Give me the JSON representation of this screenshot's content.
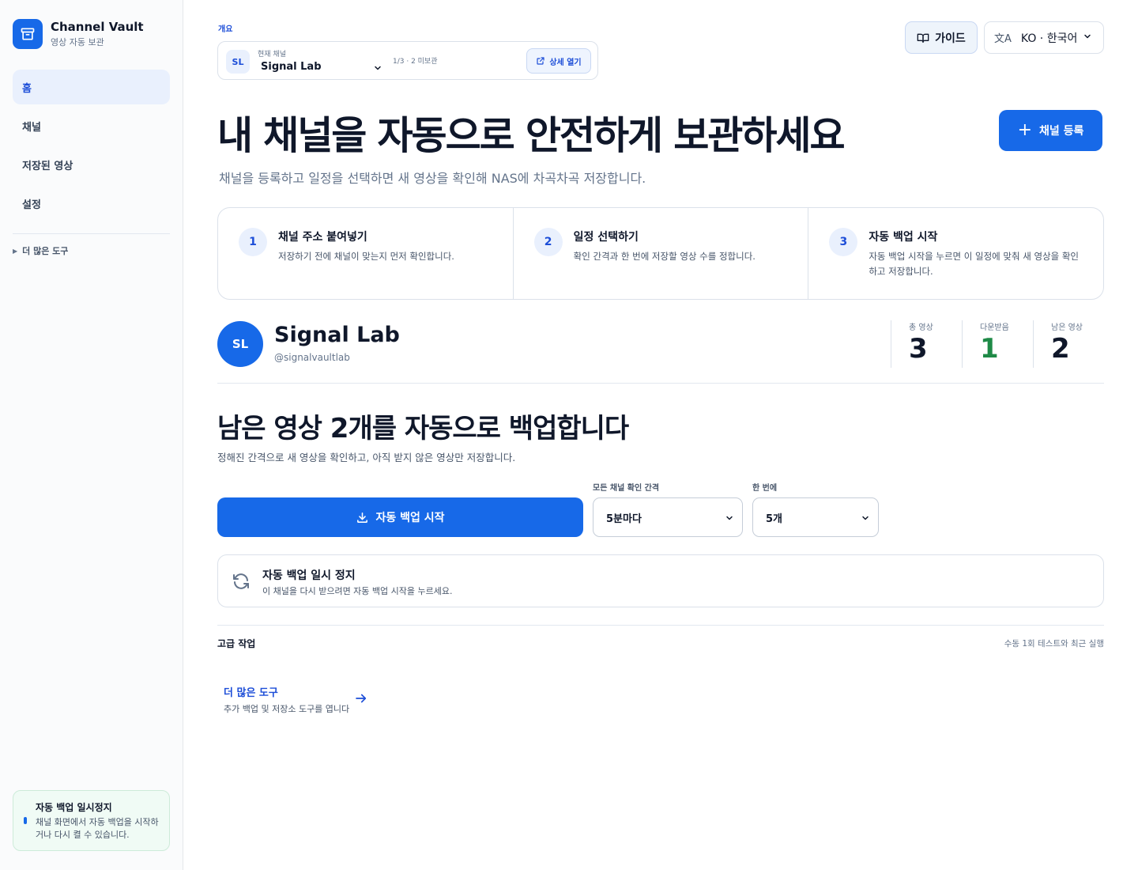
{
  "sidebar": {
    "brand_name": "Channel Vault",
    "brand_sub": "영상 자동 보관",
    "nav": [
      "홈",
      "채널",
      "저장된 영상",
      "설정"
    ],
    "more_tools": "더 많은 도구",
    "pause_card": {
      "title": "자동 백업 일시정지",
      "desc": "채널 화면에서 자동 백업을 시작하거나 다시 켤 수 있습니다."
    }
  },
  "header": {
    "overview_label": "개요",
    "channel_picker": {
      "avatar": "SL",
      "label": "현재 채널",
      "name": "Signal Lab",
      "count": "1/3 · 2 미보관",
      "open_label": "상세 열기"
    },
    "guide_label": "가이드",
    "language_label": "KO · 한국어"
  },
  "hero": {
    "title": "내 채널을 자동으로 안전하게 보관하세요",
    "subtitle": "채널을 등록하고 일정을 선택하면 새 영상을 확인해 NAS에 차곡차곡 저장합니다.",
    "register_label": "채널 등록"
  },
  "steps": [
    {
      "num": "1",
      "title": "채널 주소 붙여넣기",
      "desc": "저장하기 전에 채널이 맞는지 먼저 확인합니다."
    },
    {
      "num": "2",
      "title": "일정 선택하기",
      "desc": "확인 간격과 한 번에 저장할 영상 수를 정합니다."
    },
    {
      "num": "3",
      "title": "자동 백업 시작",
      "desc": "자동 백업 시작을 누르면 이 일정에 맞춰 새 영상을 확인하고 저장합니다."
    }
  ],
  "channel": {
    "avatar": "SL",
    "name": "Signal Lab",
    "handle": "@signalvaultlab",
    "stats": [
      {
        "label": "총 영상",
        "value": "3"
      },
      {
        "label": "다운받음",
        "value": "1"
      },
      {
        "label": "남은 영상",
        "value": "2"
      }
    ]
  },
  "backup": {
    "title": "남은 영상 2개를 자동으로 백업합니다",
    "subtitle": "정해진 간격으로 새 영상을 확인하고, 아직 받지 않은 영상만 저장합니다.",
    "start_label": "자동 백업 시작",
    "interval_label": "모든 채널 확인 간격",
    "interval_value": "5분마다",
    "batch_label": "한 번에",
    "batch_value": "5개",
    "status_title": "자동 백업 일시 정지",
    "status_desc": "이 채널을 다시 받으려면 자동 백업 시작을 누르세요."
  },
  "advanced": {
    "title": "고급 작업",
    "note": "수동 1회 테스트와 최근 실행",
    "more_title": "더 많은 도구",
    "more_desc": "추가 백업 및 저장소 도구를 엽니다"
  },
  "colors": {
    "accent": "#1769e8",
    "accent_soft": "#e9f0fd",
    "success": "#1f8a47",
    "text": "#0f172a",
    "muted": "#64748b"
  },
  "icons": [
    "archive-icon",
    "chevron-down-icon",
    "external-link-icon",
    "book-icon",
    "translate-icon",
    "plus-icon",
    "download-icon",
    "refresh-icon",
    "arrow-right-icon"
  ]
}
